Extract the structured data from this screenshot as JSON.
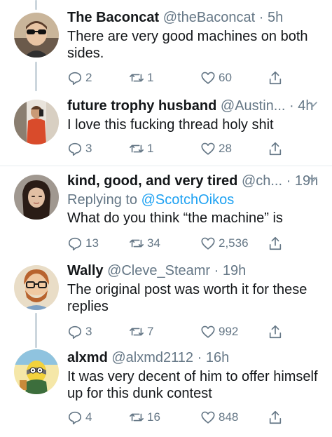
{
  "tweets": [
    {
      "name": "The Baconcat",
      "handle": "@theBaconcat",
      "time": "5h",
      "text": "There are very good machines on both sides.",
      "replies": "2",
      "retweets": "1",
      "likes": "60"
    },
    {
      "name": "future trophy husband",
      "handle": "@Austin...",
      "time": "4h",
      "text": "I love this fucking thread holy shit",
      "replies": "3",
      "retweets": "1",
      "likes": "28"
    },
    {
      "name": "kind, good, and very tired",
      "handle": "@ch...",
      "time": "19h",
      "replying_label": "Replying to",
      "replying_handle": "@ScotchOikos",
      "text": "What do you think “the machine” is",
      "replies": "13",
      "retweets": "34",
      "likes": "2,536"
    },
    {
      "name": "Wally",
      "handle": "@Cleve_Steamr",
      "time": "19h",
      "text": "The original post was worth it for these replies",
      "replies": "3",
      "retweets": "7",
      "likes": "992"
    },
    {
      "name": "alxmd",
      "handle": "@alxmd2112",
      "time": "16h",
      "text": "It was very decent of him to offer himself up for this dunk contest",
      "replies": "4",
      "retweets": "16",
      "likes": "848"
    }
  ],
  "colors": {
    "link": "#1da1f2",
    "secondary": "#657786",
    "thread_line": "#ccd6dd"
  }
}
